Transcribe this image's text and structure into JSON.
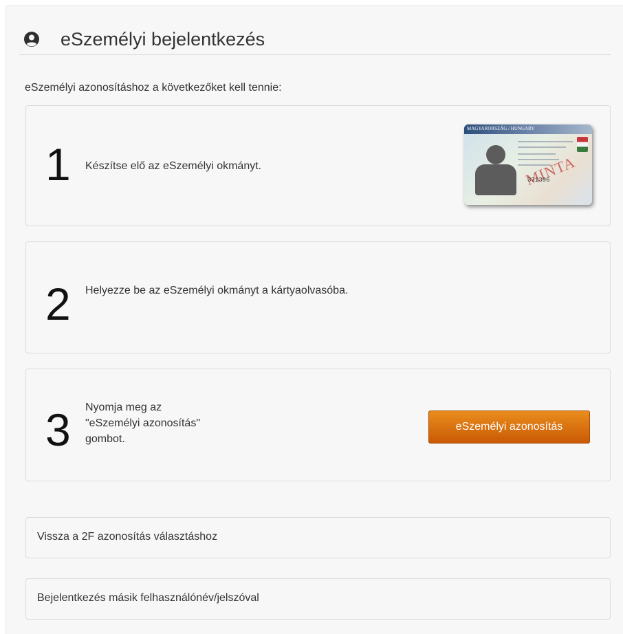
{
  "header": {
    "title": "eSzemélyi bejelentkezés",
    "icon": "user-circle-icon"
  },
  "intro": "eSzemélyi azonosításhoz a következőket kell tennie:",
  "steps": [
    {
      "number": "1",
      "text": "Készítse elő az eSzemélyi okmányt."
    },
    {
      "number": "2",
      "text": "Helyezze be az eSzemélyi okmányt a kártyaolvasóba."
    },
    {
      "number": "3",
      "lines": [
        "Nyomja meg az",
        "\"eSzemélyi azonosítás\"",
        "gombot."
      ]
    }
  ],
  "id_card": {
    "header_text": "MAGYARORSZÁG / HUNGARY",
    "specimen": "MINTA",
    "number": "371396"
  },
  "action_button": {
    "label": "eSzemélyi azonosítás",
    "color": "#d9700f"
  },
  "links": [
    {
      "label": "Vissza a 2F azonosítás választáshoz"
    },
    {
      "label": "Bejelentkezés másik felhasználónév/jelszóval"
    }
  ]
}
